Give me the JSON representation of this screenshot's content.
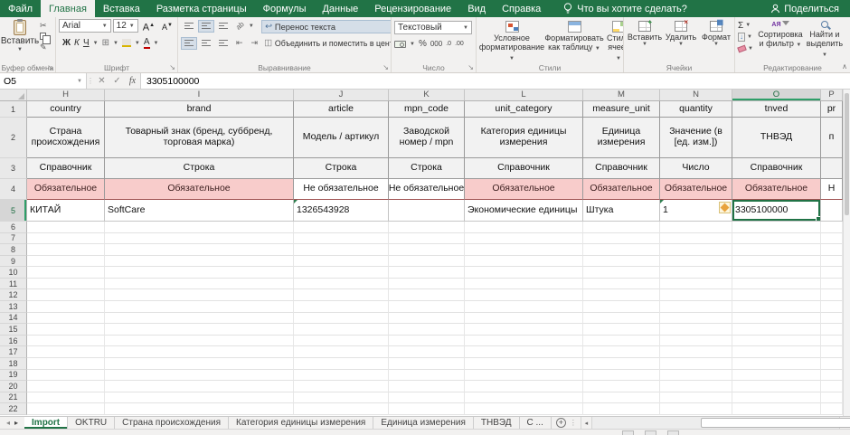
{
  "tabs": {
    "items": [
      {
        "label": "Файл",
        "active": false
      },
      {
        "label": "Главная",
        "active": true
      },
      {
        "label": "Вставка",
        "active": false
      },
      {
        "label": "Разметка страницы",
        "active": false
      },
      {
        "label": "Формулы",
        "active": false
      },
      {
        "label": "Данные",
        "active": false
      },
      {
        "label": "Рецензирование",
        "active": false
      },
      {
        "label": "Вид",
        "active": false
      },
      {
        "label": "Справка",
        "active": false
      }
    ],
    "tellme": "Что вы хотите сделать?",
    "share": "Поделиться"
  },
  "ribbon": {
    "clipboard": {
      "label": "Буфер обмена",
      "paste": "Вставить"
    },
    "font": {
      "label": "Шрифт",
      "family": "Arial",
      "size": "12",
      "bold": "Ж",
      "italic": "К",
      "underline": "Ч",
      "grow": "А",
      "shrink": "А",
      "color_letter": "А"
    },
    "alignment": {
      "label": "Выравнивание",
      "wrap": "Перенос текста",
      "merge": "Объединить и поместить в центре"
    },
    "number": {
      "label": "Число",
      "format": "Текстовый",
      "percent": "%",
      "thousand": "000",
      "dec_inc": ".0",
      "dec_dec": ".00"
    },
    "styles": {
      "label": "Стили",
      "conditional": [
        "Условное",
        "форматирование"
      ],
      "as_table": [
        "Форматировать",
        "как таблицу"
      ],
      "cell_styles": [
        "Стили",
        "ячеек"
      ]
    },
    "cells": {
      "label": "Ячейки",
      "insert": "Вставить",
      "delete": "Удалить",
      "format": "Формат"
    },
    "editing": {
      "label": "Редактирование",
      "sigma": "Σ",
      "fill": "↓",
      "sort": [
        "Сортировка",
        "и фильтр"
      ],
      "find": [
        "Найти и",
        "выделить"
      ],
      "az": "АЯ"
    }
  },
  "formula_bar": {
    "name_box": "O5",
    "fx": "fx",
    "value": "3305100000"
  },
  "grid": {
    "col_letters": [
      "H",
      "I",
      "J",
      "K",
      "L",
      "M",
      "N",
      "O",
      "P"
    ],
    "selected_col": "O",
    "selected_row": 5,
    "first_row": 1,
    "last_row": 22,
    "rows": {
      "r1": [
        "country",
        "brand",
        "article",
        "mpn_code",
        "unit_category",
        "measure_unit",
        "quantity",
        "tnved",
        "pr"
      ],
      "r2": [
        "Страна происхождения",
        "Товарный знак (бренд, суббренд, торговая марка)",
        "Модель / артикул",
        "Заводской номер / mpn",
        "Категория единицы измерения",
        "Единица измерения",
        "Значение (в [ед. изм.])",
        "ТНВЭД",
        "п"
      ],
      "r3": [
        "Справочник",
        "Строка",
        "Строка",
        "Строка",
        "Справочник",
        "Справочник",
        "Число",
        "Справочник",
        ""
      ],
      "r4": [
        "Обязательное",
        "Обязательное",
        "Не обязательное",
        "Не обязательное",
        "Обязательное",
        "Обязательное",
        "Обязательное",
        "Обязательное",
        "Н"
      ],
      "r4_pink": [
        true,
        true,
        false,
        false,
        true,
        true,
        true,
        true,
        false
      ],
      "r5": [
        "КИТАЙ",
        "SoftCare",
        "1326543928",
        "",
        "Экономические единицы",
        "Штука",
        "1",
        "3305100000",
        ""
      ]
    },
    "error_cells": [
      "J5",
      "N5"
    ]
  },
  "sheet_bar": {
    "tabs": [
      {
        "label": "Import",
        "active": true
      },
      {
        "label": "OKTRU",
        "active": false
      },
      {
        "label": "Страна происхождения",
        "active": false
      },
      {
        "label": "Категория единицы измерения",
        "active": false
      },
      {
        "label": "Единица измерения",
        "active": false
      },
      {
        "label": "ТНВЭД",
        "active": false
      },
      {
        "label": "С ...",
        "active": false
      }
    ]
  },
  "colors": {
    "accent": "#217346",
    "required_bg": "#f8cccb",
    "selection": "#217346"
  }
}
